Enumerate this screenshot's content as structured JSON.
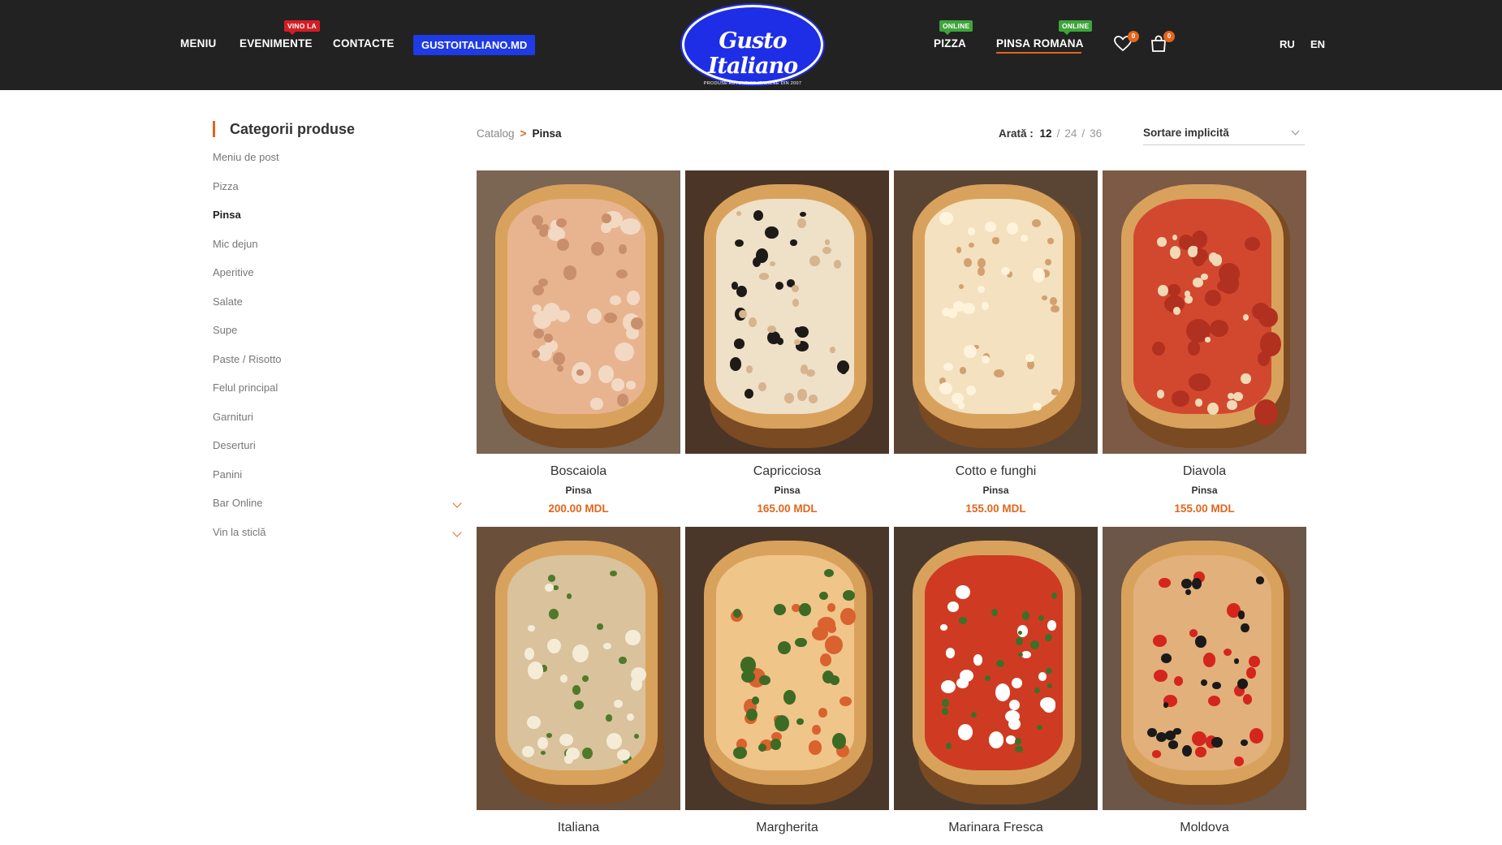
{
  "header": {
    "nav": [
      {
        "label": "MENIU"
      },
      {
        "label": "EVENIMENTE",
        "badge": "VINO LA"
      },
      {
        "label": "CONTACTE"
      }
    ],
    "site_button": "GUSTOITALIANO.MD",
    "logo": {
      "name": "Gusto Italiano",
      "tagline": "PRODUSE AUTENTICE ITALIENE DIN 2007"
    },
    "nav_right": [
      {
        "label": "PIZZA",
        "badge": "ONLINE"
      },
      {
        "label": "PINSA ROMANA",
        "badge": "ONLINE"
      }
    ],
    "wishlist_count": "0",
    "cart_count": "0",
    "languages": [
      "RU",
      "EN"
    ],
    "colors": {
      "bar": "#222222",
      "accent": "#e2661c",
      "brand_blue": "#1e3be6",
      "badge_red": "#d31e25",
      "badge_green": "#3da53a"
    }
  },
  "sidebar": {
    "title": "Categorii produse",
    "items": [
      {
        "label": "Meniu de post"
      },
      {
        "label": "Pizza"
      },
      {
        "label": "Pinsa",
        "active": true
      },
      {
        "label": "Mic dejun"
      },
      {
        "label": "Aperitive"
      },
      {
        "label": "Salate"
      },
      {
        "label": "Supe"
      },
      {
        "label": "Paste / Risotto"
      },
      {
        "label": "Felul principal"
      },
      {
        "label": "Garnituri"
      },
      {
        "label": "Deserturi"
      },
      {
        "label": "Panini"
      },
      {
        "label": "Bar Online",
        "expandable": true
      },
      {
        "label": "Vin la sticlă",
        "expandable": true
      }
    ]
  },
  "toolbar": {
    "breadcrumb": {
      "root": "Catalog",
      "separator": ">",
      "current": "Pinsa"
    },
    "per_page_label": "Arată :",
    "per_page_options": [
      "12",
      "24",
      "36"
    ],
    "per_page_selected": "12",
    "sort_value": "Sortare implicită"
  },
  "products": [
    {
      "name": "Boscaiola",
      "category": "Pinsa",
      "price": "200.00 MDL"
    },
    {
      "name": "Capricciosa",
      "category": "Pinsa",
      "price": "165.00 MDL"
    },
    {
      "name": "Cotto e funghi",
      "category": "Pinsa",
      "price": "155.00 MDL"
    },
    {
      "name": "Diavola",
      "category": "Pinsa",
      "price": "155.00 MDL"
    },
    {
      "name": "Italiana",
      "category": "",
      "price": ""
    },
    {
      "name": "Margherita",
      "category": "",
      "price": ""
    },
    {
      "name": "Marinara Fresca",
      "category": "",
      "price": ""
    },
    {
      "name": "Moldova",
      "category": "",
      "price": ""
    }
  ]
}
